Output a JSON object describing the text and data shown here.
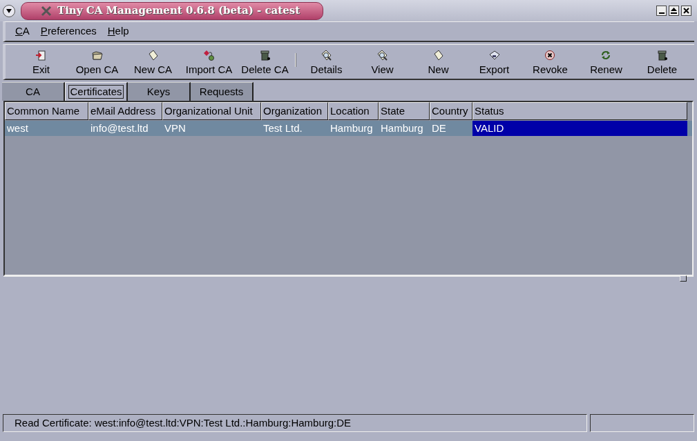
{
  "window": {
    "title": "Tiny CA Management 0.6.8 (beta) - catest"
  },
  "menu": [
    {
      "label": "CA"
    },
    {
      "label": "Preferences"
    },
    {
      "label": "Help"
    }
  ],
  "toolbar": [
    {
      "label": "Exit",
      "kind": "exit"
    },
    {
      "label": "Open CA",
      "kind": "open"
    },
    {
      "label": "New CA",
      "kind": "new"
    },
    {
      "label": "Import CA",
      "kind": "import"
    },
    {
      "label": "Delete CA",
      "kind": "trash"
    },
    {
      "kind": "separator"
    },
    {
      "label": "Details",
      "kind": "details"
    },
    {
      "label": "View",
      "kind": "details"
    },
    {
      "label": "New",
      "kind": "new"
    },
    {
      "label": "Export",
      "kind": "export"
    },
    {
      "label": "Revoke",
      "kind": "revoke"
    },
    {
      "label": "Renew",
      "kind": "renew"
    },
    {
      "label": "Delete",
      "kind": "trash"
    }
  ],
  "tabs": [
    {
      "label": "CA",
      "selected": false
    },
    {
      "label": "Certificates",
      "selected": true
    },
    {
      "label": "Keys",
      "selected": false
    },
    {
      "label": "Requests",
      "selected": false
    }
  ],
  "table": {
    "columns": [
      "Common Name",
      "eMail Address",
      "Organizational Unit",
      "Organization",
      "Location",
      "State",
      "Country",
      "Status"
    ],
    "rows": [
      {
        "selected": true,
        "cells": [
          "west",
          "info@test.ltd",
          "VPN",
          "Test Ltd.",
          "Hamburg",
          "Hamburg",
          "DE",
          "VALID"
        ]
      }
    ]
  },
  "status_bar": {
    "message": "Read Certificate: west:info@test.ltd:VPN:Test Ltd.:Hamburg:Hamburg:DE"
  }
}
